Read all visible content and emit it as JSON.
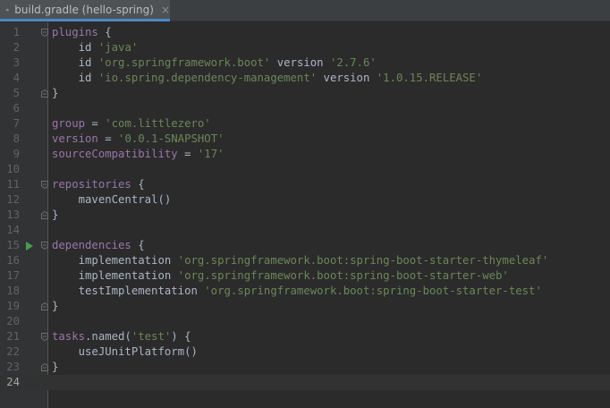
{
  "tab": {
    "title": "build.gradle (hello-spring)",
    "close": "×",
    "icon": "gradle-elephant-icon"
  },
  "colors": {
    "background": "#2b2b2b",
    "gutter": "#313335",
    "keyword": "#cc7832",
    "string": "#6a8759",
    "identifier": "#9876aa",
    "text": "#a9b7c6",
    "run_marker": "#499c54",
    "tab_underline": "#4a88c7"
  },
  "current_line": 24,
  "lines": [
    {
      "n": "1",
      "fold": "open",
      "tokens": [
        {
          "c": "fn",
          "t": "plugins"
        },
        {
          "c": "plain",
          "t": " {"
        }
      ]
    },
    {
      "n": "2",
      "tokens": [
        {
          "c": "plain",
          "t": "    id "
        },
        {
          "c": "str",
          "t": "'java'"
        }
      ]
    },
    {
      "n": "3",
      "tokens": [
        {
          "c": "plain",
          "t": "    id "
        },
        {
          "c": "str",
          "t": "'org.springframework.boot'"
        },
        {
          "c": "plain",
          "t": " version "
        },
        {
          "c": "str",
          "t": "'2.7.6'"
        }
      ]
    },
    {
      "n": "4",
      "tokens": [
        {
          "c": "plain",
          "t": "    id "
        },
        {
          "c": "str",
          "t": "'io.spring.dependency-management'"
        },
        {
          "c": "plain",
          "t": " version "
        },
        {
          "c": "str",
          "t": "'1.0.15.RELEASE'"
        }
      ]
    },
    {
      "n": "5",
      "fold": "close",
      "tokens": [
        {
          "c": "plain",
          "t": "}"
        }
      ]
    },
    {
      "n": "6",
      "tokens": []
    },
    {
      "n": "7",
      "tokens": [
        {
          "c": "fn",
          "t": "group"
        },
        {
          "c": "plain",
          "t": " = "
        },
        {
          "c": "str",
          "t": "'com.littlezero'"
        }
      ]
    },
    {
      "n": "8",
      "tokens": [
        {
          "c": "fn",
          "t": "version"
        },
        {
          "c": "plain",
          "t": " = "
        },
        {
          "c": "str",
          "t": "'0.0.1-SNAPSHOT'"
        }
      ]
    },
    {
      "n": "9",
      "tokens": [
        {
          "c": "fn",
          "t": "sourceCompatibility"
        },
        {
          "c": "plain",
          "t": " = "
        },
        {
          "c": "str",
          "t": "'17'"
        }
      ]
    },
    {
      "n": "10",
      "tokens": []
    },
    {
      "n": "11",
      "fold": "open",
      "tokens": [
        {
          "c": "fn",
          "t": "repositories"
        },
        {
          "c": "plain",
          "t": " {"
        }
      ]
    },
    {
      "n": "12",
      "tokens": [
        {
          "c": "plain",
          "t": "    mavenCentral()"
        }
      ]
    },
    {
      "n": "13",
      "fold": "close",
      "tokens": [
        {
          "c": "plain",
          "t": "}"
        }
      ]
    },
    {
      "n": "14",
      "tokens": []
    },
    {
      "n": "15",
      "fold": "open",
      "run": true,
      "tokens": [
        {
          "c": "fn",
          "t": "dependencies"
        },
        {
          "c": "plain",
          "t": " {"
        }
      ]
    },
    {
      "n": "16",
      "tokens": [
        {
          "c": "plain",
          "t": "    implementation "
        },
        {
          "c": "str",
          "t": "'org.springframework.boot:spring-boot-starter-thymeleaf'"
        }
      ]
    },
    {
      "n": "17",
      "tokens": [
        {
          "c": "plain",
          "t": "    implementation "
        },
        {
          "c": "str",
          "t": "'org.springframework.boot:spring-boot-starter-web'"
        }
      ]
    },
    {
      "n": "18",
      "tokens": [
        {
          "c": "plain",
          "t": "    testImplementation "
        },
        {
          "c": "str",
          "t": "'org.springframework.boot:spring-boot-starter-test'"
        }
      ]
    },
    {
      "n": "19",
      "fold": "close",
      "tokens": [
        {
          "c": "plain",
          "t": "}"
        }
      ]
    },
    {
      "n": "20",
      "tokens": []
    },
    {
      "n": "21",
      "fold": "open",
      "tokens": [
        {
          "c": "fn",
          "t": "tasks"
        },
        {
          "c": "plain",
          "t": ".named("
        },
        {
          "c": "str",
          "t": "'test'"
        },
        {
          "c": "plain",
          "t": ") {"
        }
      ]
    },
    {
      "n": "22",
      "tokens": [
        {
          "c": "plain",
          "t": "    useJUnitPlatform()"
        }
      ]
    },
    {
      "n": "23",
      "fold": "close",
      "tokens": [
        {
          "c": "plain",
          "t": "}"
        }
      ]
    },
    {
      "n": "24",
      "tokens": []
    }
  ]
}
